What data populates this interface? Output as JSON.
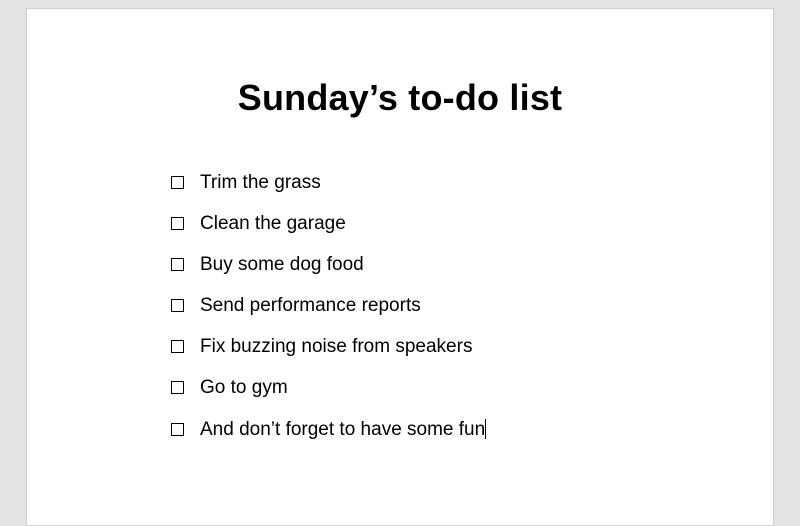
{
  "title": "Sunday’s to-do list",
  "items": [
    {
      "label": "Trim the grass",
      "checked": false
    },
    {
      "label": "Clean the garage",
      "checked": false
    },
    {
      "label": "Buy some dog food",
      "checked": false
    },
    {
      "label": "Send performance reports",
      "checked": false
    },
    {
      "label": "Fix buzzing noise from speakers",
      "checked": false
    },
    {
      "label": "Go to gym",
      "checked": false
    },
    {
      "label": "And don’t forget to have some fun",
      "checked": false
    }
  ],
  "cursor_after_item": 6
}
